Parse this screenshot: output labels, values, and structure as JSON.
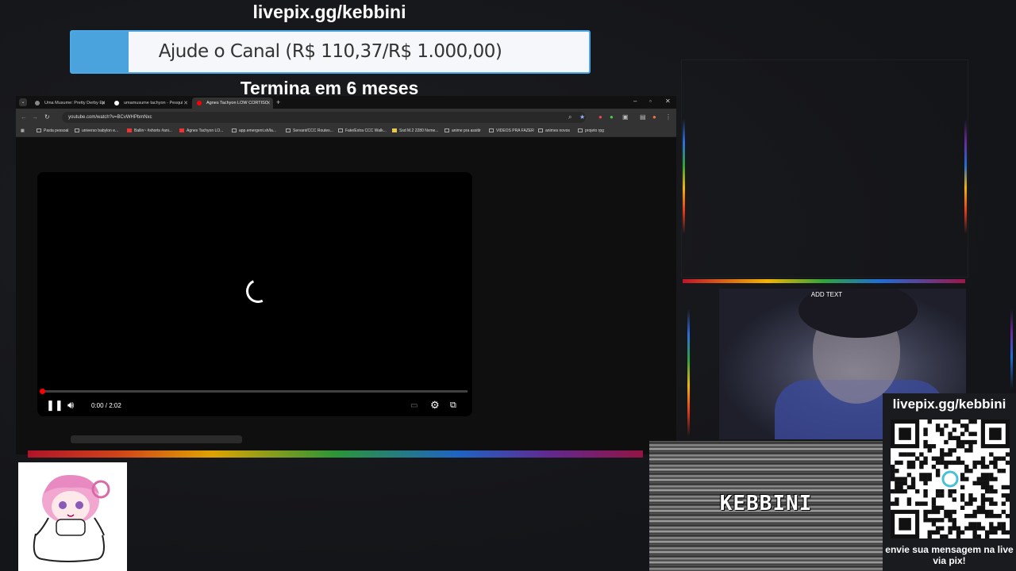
{
  "donation": {
    "url": "livepix.gg/kebbini",
    "goal_text": "Ajude o Canal (R$ 110,37/R$ 1.000,00)",
    "goal_fraction": 0.11037,
    "ends_text": "Termina em 6 meses"
  },
  "browser": {
    "tabs": [
      {
        "label": "Uma Musume: Pretty Derby Ep"
      },
      {
        "label": "umamusume tachyon - Pesqui"
      },
      {
        "label": "Agnes Tachyon LOW CORTISO"
      }
    ],
    "url": "youtube.com/watch?v=BCvWHPbmNxc",
    "bookmarks": [
      "Pasta pessoal",
      "universo babylon e...",
      "Ballin~ #shorts #ani...",
      "Agnes Tachyon LO...",
      "app.emergent.sh/la...",
      "Servant/CCC Routes...",
      "Fate/Extra CCC Walk...",
      "Ssd M.2 2280 Nvme...",
      "anime pra assitir",
      "VIDEOS PRA FAZER",
      "animes novos",
      "projeto rpg"
    ]
  },
  "player": {
    "time": "0:00 / 2:02",
    "progress": 0.0
  },
  "webcam": {
    "overlay_text": "ADD TEXT"
  },
  "name_panel": {
    "name": "KEBBINI"
  },
  "qr_panel": {
    "url": "livepix.gg/kebbini",
    "cta": "envie sua mensagem na live via pix!"
  }
}
